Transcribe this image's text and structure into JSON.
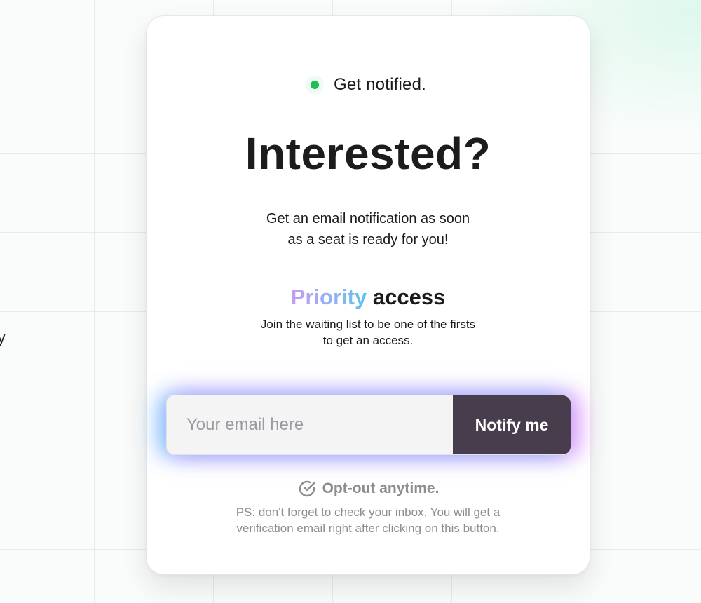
{
  "background": {
    "edge_fragment_text": "y"
  },
  "status": {
    "label": "Get notified.",
    "dot_color": "#1fbf57"
  },
  "headline": "Interested?",
  "subline": {
    "line1": "Get an email notification as soon",
    "line2": "as a seat is ready for you!"
  },
  "priority": {
    "highlight": "Priority",
    "rest": " access",
    "desc_line1": "Join the waiting list to be one of the firsts",
    "desc_line2": "to get an access."
  },
  "form": {
    "email_placeholder": "Your email here",
    "email_value": "",
    "button_label": "Notify me",
    "button_color": "#473d4c"
  },
  "optout": {
    "icon": "check-circle-icon",
    "label": "Opt-out anytime."
  },
  "note": {
    "line1": "PS: don't forget to check your inbox. You will get a",
    "line2": "verification email right after clicking on this button."
  }
}
